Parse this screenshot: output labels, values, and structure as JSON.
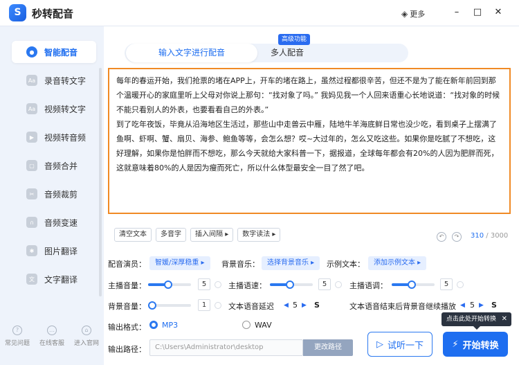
{
  "app": {
    "title": "秒转配音",
    "more_label": "更多"
  },
  "sidebar": {
    "items": [
      {
        "label": "智能配音"
      },
      {
        "label": "录音转文字"
      },
      {
        "label": "视频转文字"
      },
      {
        "label": "视频转音频"
      },
      {
        "label": "音频合并"
      },
      {
        "label": "音频裁剪"
      },
      {
        "label": "音频变速"
      },
      {
        "label": "图片翻译"
      },
      {
        "label": "文字翻译"
      }
    ],
    "bottom": [
      {
        "label": "常见问题"
      },
      {
        "label": "在线客服"
      },
      {
        "label": "进入官网"
      }
    ]
  },
  "tabs": [
    {
      "label": "输入文字进行配音"
    },
    {
      "label": "多人配音"
    }
  ],
  "badge": "高级功能",
  "editor": {
    "text": "每年的春运开始，我们抢票的堵在APP上，开车的堵在路上，虽然过程都很辛苦，但还不是为了能在新年前回到那个温暖开心的家庭里听上父母对你说上那句：“找对象了吗。” 我妈见我一个人回来语重心长地说道：“找对象的时候不能只看别人的外表，也要看看自己的外表。”\n到了吃年夜饭，毕竟从沿海地区生活过，那些山中走兽云中雁，陆地牛羊海底鲜日常也没少吃，看到桌子上摆满了鱼啊、虾啊、蟹、扇贝、海参、鲍鱼等等，会怎么想？哎~大过年的，怎么又吃这些。如果你是吃腻了不想吃，这好理解，如果你是怕胖而不想吃，那么今天就给大家科普一下，据报道，全球每年都会有20%的人因为肥胖而死，这就意味着80%的人是因为瘦而死亡，所以什么体型最安全一目了然了吧。"
  },
  "toolbar": {
    "clear": "清空文本",
    "polyphone": "多音字",
    "insert_pause": "插入间隔",
    "number_read": "数字读法",
    "count_current": "310",
    "count_max": "/ 3000"
  },
  "settings": {
    "voice_label": "配音演员：",
    "voice_value": "智媛/深厚稳重",
    "bgm_label": "背景音乐：",
    "bgm_value": "选择背景音乐",
    "sample_label": "示例文本：",
    "sample_value": "添加示例文本",
    "volume_label": "主播音量：",
    "volume_value": "5",
    "speed_label": "主播语速：",
    "speed_value": "5",
    "pitch_label": "主播语调：",
    "pitch_value": "5",
    "bg_volume_label": "背景音量：",
    "bg_volume_value": "1",
    "delay_label": "文本语音延迟",
    "delay_value": "5",
    "delay_unit": "S",
    "continue_label": "文本语音结束后背景音继续播放",
    "continue_value": "5",
    "continue_unit": "S",
    "format_label": "输出格式：",
    "format_options": [
      "MP3",
      "WAV"
    ],
    "selected_format": "MP3",
    "path_label": "输出路径：",
    "path_value": "C:\\Users\\Administrator\\desktop",
    "change_path": "更改路径"
  },
  "actions": {
    "listen": "试听一下",
    "start": "开始转换",
    "tip": "点击此处开始转换"
  },
  "colors": {
    "accent": "#1e6ef0",
    "editor_border": "#f08a24",
    "titlebar_bg": "#ffffff",
    "sidebar_bg": "#eef3fb"
  }
}
